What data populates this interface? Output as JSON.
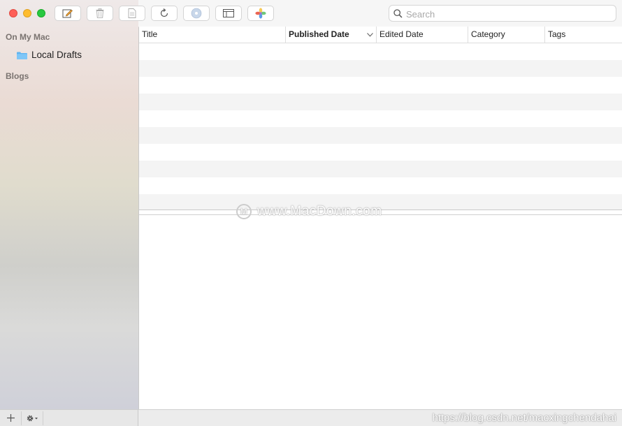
{
  "sidebar": {
    "section_local": "On My Mac",
    "local_item": "Local Drafts",
    "section_blogs": "Blogs"
  },
  "toolbar": {
    "buttons": [
      "new-post-icon",
      "trash-icon",
      "document-icon",
      "refresh-icon",
      "disc-icon",
      "layout-icon",
      "photos-icon"
    ]
  },
  "search": {
    "placeholder": "Search",
    "value": ""
  },
  "table": {
    "columns": [
      "Title",
      "Published Date",
      "Edited Date",
      "Category",
      "Tags"
    ],
    "sort_column": "Published Date",
    "rows": []
  },
  "watermark": {
    "text": "www.MacDown.com"
  },
  "url_watermark": "https://blog.csdn.net/macxingchendahai",
  "colors": {
    "close": "#fe5f57",
    "minimize": "#febc2e",
    "zoom": "#28c840",
    "folder": "#5fb4f0"
  }
}
